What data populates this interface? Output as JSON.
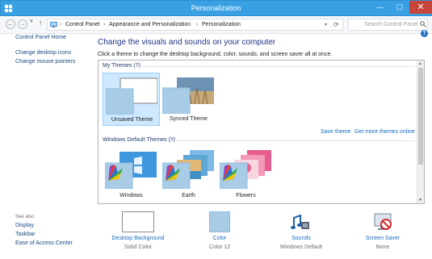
{
  "window": {
    "title": "Personalization",
    "minimize_glyph": "—",
    "maximize_glyph": "☐",
    "close_glyph": "✕"
  },
  "address": {
    "breadcrumbs": [
      "Control Panel",
      "Appearance and Personalization",
      "Personalization"
    ],
    "separator": "›",
    "search_placeholder": "Search Control Panel"
  },
  "left_pane": {
    "links": [
      "Control Panel Home",
      "Change desktop icons",
      "Change mouse pointers"
    ],
    "see_also": {
      "heading": "See also",
      "links": [
        "Display",
        "Taskbar",
        "Ease of Access Center"
      ]
    }
  },
  "main": {
    "title": "Change the visuals and sounds on your computer",
    "description": "Click a theme to change the desktop background, color, sounds, and screen saver all at once.",
    "my_themes": {
      "heading": "My Themes (2)",
      "items": [
        "Unsaved Theme",
        "Synced Theme"
      ],
      "selected": "Unsaved Theme"
    },
    "links": {
      "save": "Save theme",
      "more": "Get more themes online"
    },
    "default_themes": {
      "heading": "Windows Default Themes (3)",
      "items": [
        "Windows",
        "Earth",
        "Flowers"
      ]
    }
  },
  "bottom": {
    "items": [
      {
        "label": "Desktop Background",
        "sub": "Solid Color"
      },
      {
        "label": "Color",
        "sub": "Color 12"
      },
      {
        "label": "Sounds",
        "sub": "Windows Default"
      },
      {
        "label": "Screen Saver",
        "sub": "None"
      }
    ]
  },
  "colors": {
    "title_bar": "#39a0e3",
    "accent_blue": "#1e3287",
    "link_blue": "#1a6bc0",
    "selected_tile": "#cde8ff"
  },
  "icons": [
    "windows-logo-icon",
    "back-arrow-icon",
    "forward-arrow-icon",
    "up-arrow-icon",
    "control-panel-icon",
    "refresh-icon",
    "search-icon",
    "help-icon",
    "paint-palette-icon",
    "sounds-icon",
    "screen-saver-icon"
  ]
}
